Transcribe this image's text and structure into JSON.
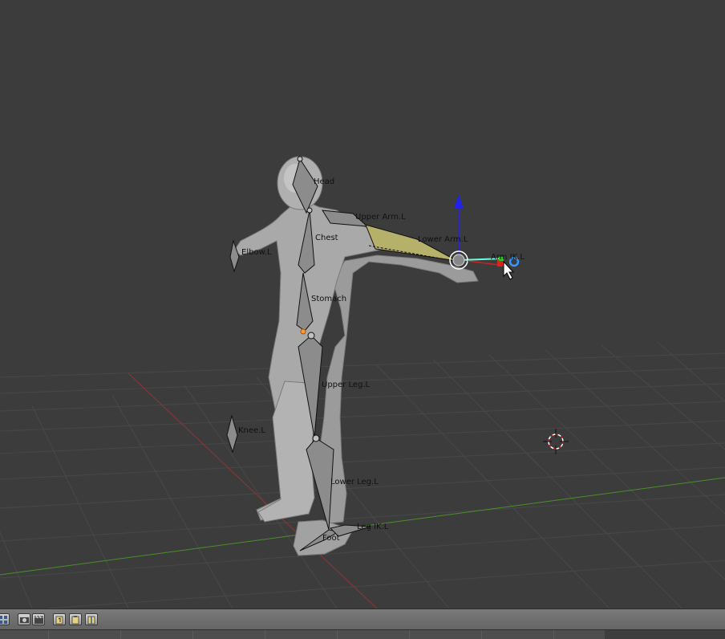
{
  "viewport": {
    "bones": {
      "head": "Head",
      "upper_arm": "Upper Arm.L",
      "chest": "Chest",
      "lower_arm": "Lower Arm.L",
      "arm_ik": "Arm IK.L",
      "elbow": "Elbow.L",
      "stomach": "Stomach",
      "upper_leg": "Upper Leg.L",
      "knee": "Knee.L",
      "lower_leg": "Lower Leg.L",
      "leg_ik": "Leg IK.L",
      "foot": "Foot"
    },
    "colors": {
      "background": "#3c3c3c",
      "grid": "#4a4a4a",
      "x_axis": "#9a3a3a",
      "y_axis": "#4f9a2a",
      "selected_bone": "#b9b46a",
      "z_gizmo": "#2222ee",
      "cursor": "#cc2222"
    }
  },
  "header": {
    "buttons": [
      "view-layers-icon",
      "render-icon",
      "clapper-icon",
      "paste-pose-icon",
      "copy-pose-icon",
      "flip-pose-icon"
    ]
  }
}
